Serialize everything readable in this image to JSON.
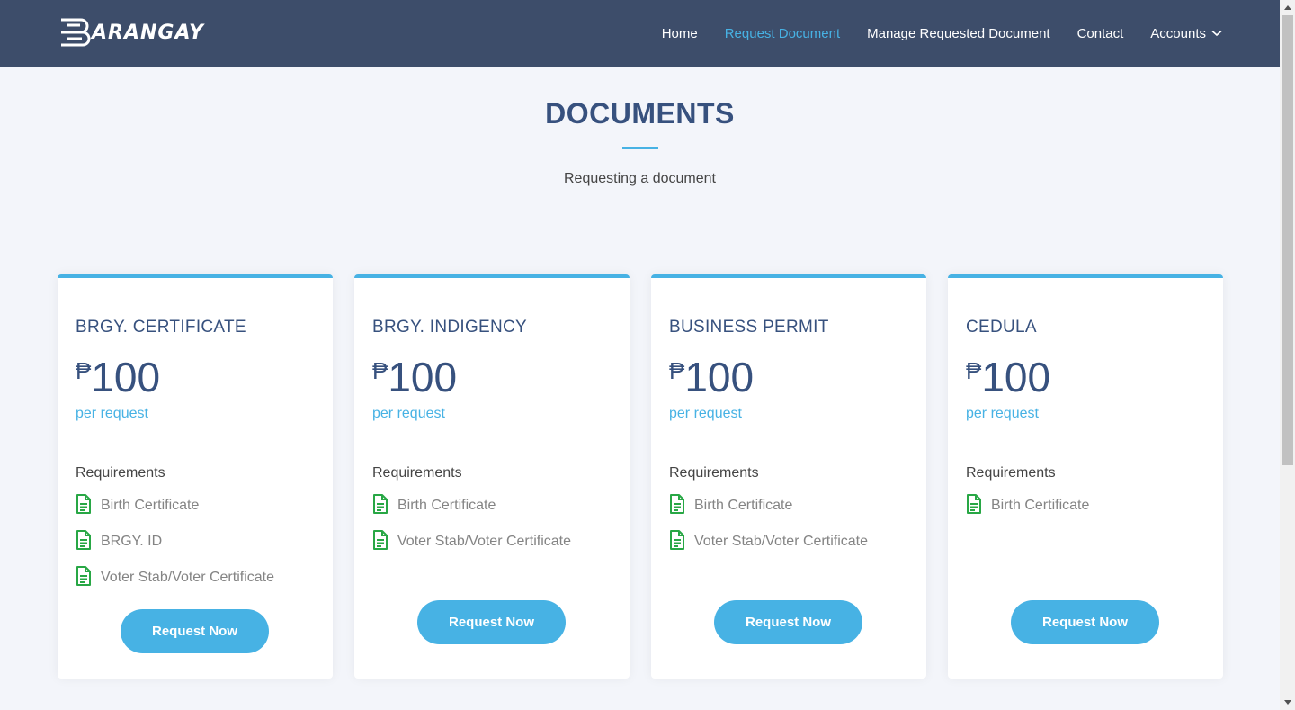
{
  "brand": {
    "logo_text": "ARANGAY",
    "logo_letter": "B"
  },
  "nav": {
    "items": [
      {
        "label": "Home",
        "active": false
      },
      {
        "label": "Request Document",
        "active": true
      },
      {
        "label": "Manage Requested Document",
        "active": false
      },
      {
        "label": "Contact",
        "active": false
      },
      {
        "label": "Accounts",
        "active": false,
        "dropdown": true
      }
    ]
  },
  "section": {
    "title": "DOCUMENTS",
    "subtitle": "Requesting a document"
  },
  "cards": [
    {
      "title": "BRGY. CERTIFICATE",
      "currency": "₱",
      "price": "100",
      "per": "per request",
      "requirements_label": "Requirements",
      "requirements": [
        "Birth Certificate",
        "BRGY. ID",
        "Voter Stab/Voter Certificate"
      ],
      "button": "Request Now"
    },
    {
      "title": "BRGY. INDIGENCY",
      "currency": "₱",
      "price": "100",
      "per": "per request",
      "requirements_label": "Requirements",
      "requirements": [
        "Birth Certificate",
        "Voter Stab/Voter Certificate"
      ],
      "button": "Request Now"
    },
    {
      "title": "BUSINESS PERMIT",
      "currency": "₱",
      "price": "100",
      "per": "per request",
      "requirements_label": "Requirements",
      "requirements": [
        "Birth Certificate",
        "Voter Stab/Voter Certificate"
      ],
      "button": "Request Now"
    },
    {
      "title": "CEDULA",
      "currency": "₱",
      "price": "100",
      "per": "per request",
      "requirements_label": "Requirements",
      "requirements": [
        "Birth Certificate"
      ],
      "button": "Request Now"
    }
  ],
  "colors": {
    "header_bg": "#3d4d6a",
    "accent": "#47b2e4",
    "heading": "#37517e",
    "doc_icon": "#28a745"
  }
}
